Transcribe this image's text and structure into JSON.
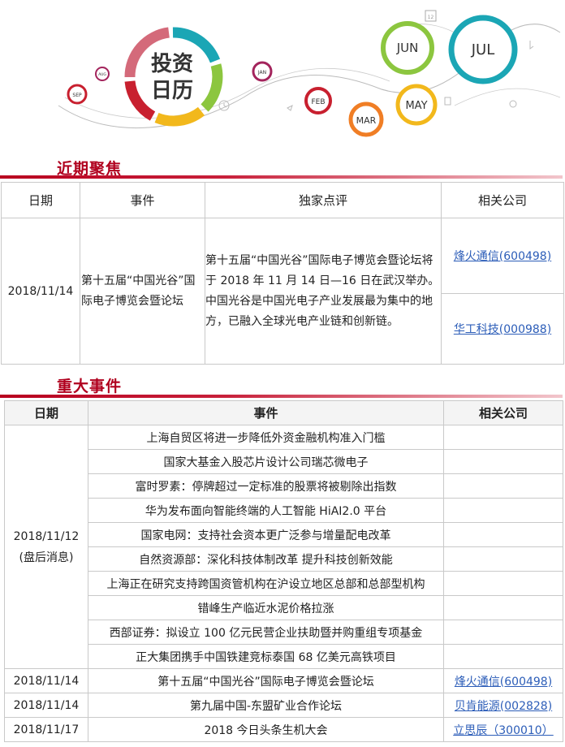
{
  "banner": {
    "logo_line1": "投资",
    "logo_line2": "日历",
    "months": [
      "SEP",
      "AUG",
      "JAN",
      "FEB",
      "MAR",
      "MAY",
      "JUN",
      "JUL"
    ],
    "calendar_day": "12",
    "colors": {
      "red": "#c8202f",
      "teal": "#1ba6b5",
      "yellow": "#f2b81c",
      "orange": "#f07e25",
      "green": "#8cc63f",
      "purple": "#a3245c"
    }
  },
  "focus": {
    "title": "近期聚焦",
    "headers": [
      "日期",
      "事件",
      "独家点评",
      "相关公司"
    ],
    "row": {
      "date": "2018/11/14",
      "event": "第十五届“中国光谷”国际电子博览会暨论坛",
      "comment": "第十五届“中国光谷”国际电子博览会暨论坛将于 2018 年 11 月 14 日—16 日在武汉举办。中国光谷是中国光电子产业发展最为集中的地方，已融入全球光电产业链和创新链。",
      "companies": [
        "烽火通信(600498)",
        "华工科技(000988)"
      ]
    }
  },
  "major": {
    "title": "重大事件",
    "headers": [
      "日期",
      "事件",
      "相关公司"
    ],
    "group_date": "2018/11/12",
    "group_note": "(盘后消息)",
    "group_events": [
      "上海自贸区将进一步降低外资金融机构准入门槛",
      "国家大基金入股芯片设计公司瑞芯微电子",
      "富时罗素：停牌超过一定标准的股票将被剔除出指数",
      "华为发布面向智能终端的人工智能 HiAI2.0 平台",
      "国家电网：支持社会资本更广泛参与增量配电改革",
      "自然资源部：深化科技体制改革 提升科技创新效能",
      "上海正在研究支持跨国资管机构在沪设立地区总部和总部型机构",
      "错峰生产临近水泥价格拉涨",
      "西部证券：拟设立 100 亿元民营企业扶助暨并购重组专项基金",
      "正大集团携手中国铁建竞标泰国 68 亿美元高铁项目"
    ],
    "rows": [
      {
        "date": "2018/11/14",
        "event": "第十五届“中国光谷”国际电子博览会暨论坛",
        "company": "烽火通信(600498)"
      },
      {
        "date": "2018/11/14",
        "event": "第九届中国-东盟矿业合作论坛",
        "company": "贝肯能源(002828)"
      },
      {
        "date": "2018/11/17",
        "event": "2018 今日头条生机大会",
        "company": "立思辰（300010）"
      }
    ]
  }
}
